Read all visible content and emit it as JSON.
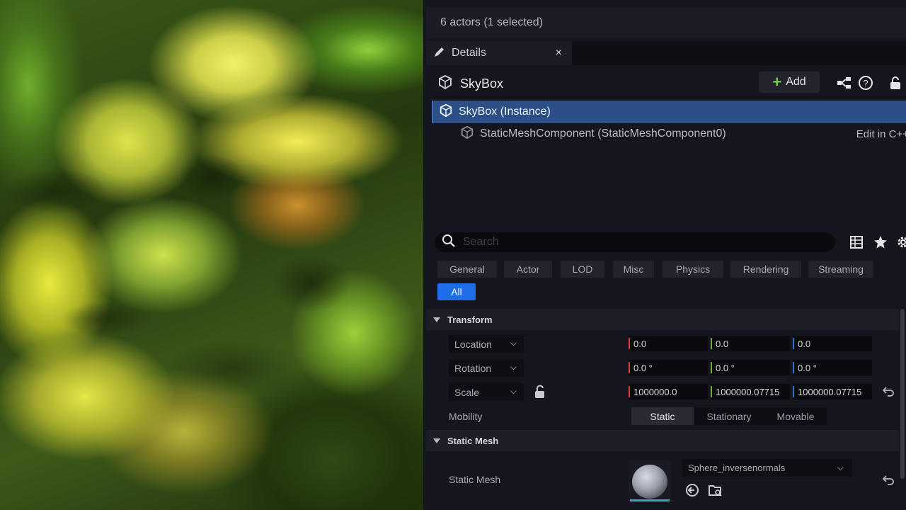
{
  "outliner": {
    "status": "6 actors (1 selected)"
  },
  "details_tab": {
    "label": "Details",
    "close": "×"
  },
  "header": {
    "title": "SkyBox",
    "add_label": "Add"
  },
  "tree": {
    "selected": "SkyBox (Instance)",
    "child": "StaticMeshComponent (StaticMeshComponent0)",
    "edit_link": "Edit in C++"
  },
  "search": {
    "placeholder": "Search"
  },
  "filters": [
    "General",
    "Actor",
    "LOD",
    "Misc",
    "Physics",
    "Rendering",
    "Streaming",
    "All"
  ],
  "transform": {
    "section": "Transform",
    "location": {
      "label": "Location",
      "x": "0.0",
      "y": "0.0",
      "z": "0.0"
    },
    "rotation": {
      "label": "Rotation",
      "x": "0.0 °",
      "y": "0.0 °",
      "z": "0.0 °"
    },
    "scale": {
      "label": "Scale",
      "x": "1000000.0",
      "y": "1000000.07715",
      "z": "1000000.07715"
    },
    "mobility": {
      "label": "Mobility",
      "options": [
        "Static",
        "Stationary",
        "Movable"
      ],
      "selected": "Static"
    }
  },
  "static_mesh": {
    "section": "Static Mesh",
    "label": "Static Mesh",
    "value": "Sphere_inversenormals"
  },
  "colors": {
    "selected_row": "#2b4f86",
    "active_chip": "#1d6ee8",
    "add_plus": "#6fd04a"
  }
}
